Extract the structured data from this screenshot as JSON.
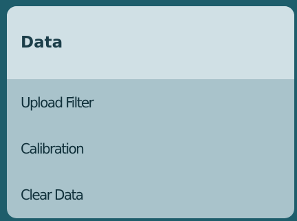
{
  "panel": {
    "title": "Data",
    "items": [
      {
        "label": "Upload Filter"
      },
      {
        "label": "Calibration"
      },
      {
        "label": "Clear Data"
      }
    ]
  },
  "colors": {
    "background": "#1e5d6b",
    "header_bg": "#d0e0e5",
    "menu_bg": "#a9c3cb",
    "text": "#0f2f39"
  }
}
